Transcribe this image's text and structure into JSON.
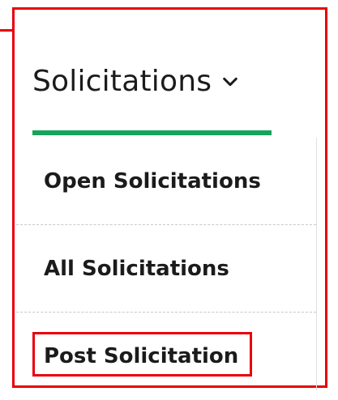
{
  "nav": {
    "title": "Solicitations",
    "toggle_icon": "chevron-down-icon",
    "accent_color": "#14a55a",
    "highlight_color": "#e8000b"
  },
  "menu": {
    "items": [
      {
        "label": "Open Solicitations"
      },
      {
        "label": "All Solicitations"
      },
      {
        "label": "Post Solicitation"
      }
    ]
  }
}
